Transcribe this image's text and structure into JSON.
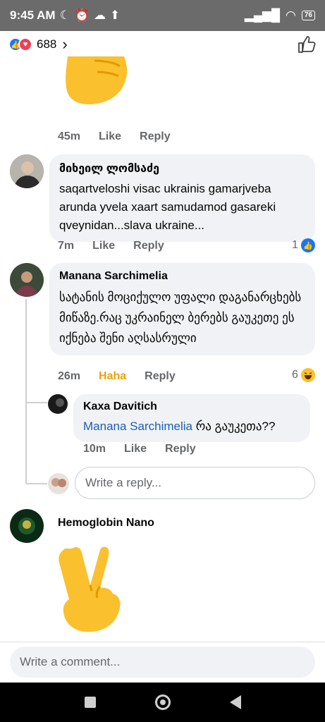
{
  "status_bar": {
    "time": "9:45 AM",
    "battery": "76"
  },
  "reactions": {
    "count": "688"
  },
  "comments": [
    {
      "actions": {
        "time": "45m",
        "like": "Like",
        "reply": "Reply"
      }
    },
    {
      "author": "მიხეილ ლომსაძე",
      "text": "saqartveloshi visac ukrainis gamarjveba arunda yvela xaart samudamod gasareki qveynidan...slava ukraine...",
      "actions": {
        "time": "7m",
        "like": "Like",
        "reply": "Reply"
      },
      "reaction_count": "1"
    },
    {
      "author": "Manana Sarchimelia",
      "text": "სატანის მოციქულო უფალი დაგანარცხებს მიწაზე.რაც უკრაინელ ბერებს გაუკეთე ეს იქნება შენი აღსასრული",
      "actions": {
        "time": "26m",
        "like": "Haha",
        "reply": "Reply"
      },
      "reaction_count": "6",
      "reply": {
        "author": "Kaxa Davitich",
        "mention": "Manana Sarchimelia",
        "text": "რა გაუკეთა??",
        "actions": {
          "time": "10m",
          "like": "Like",
          "reply": "Reply"
        }
      }
    },
    {
      "author": "Hemoglobin Nano"
    }
  ],
  "reply_input_placeholder": "Write a reply...",
  "comment_input_placeholder": "Write a comment...",
  "colors": {
    "like_blue": "#1877f2",
    "haha_orange": "#e9a30b",
    "mention_blue": "#1b5fb8",
    "bubble_bg": "#f0f2f5"
  }
}
